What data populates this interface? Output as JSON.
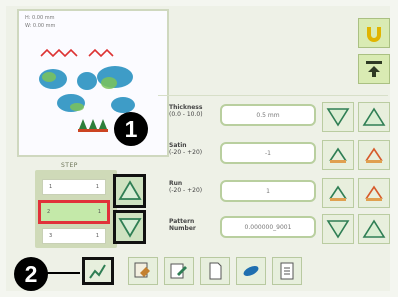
{
  "preview": {
    "line1": "H: 0.00 mm",
    "line2": "W: 0.00 mm"
  },
  "step": {
    "label": "STEP",
    "rows": [
      {
        "num": "1",
        "val": "1"
      },
      {
        "num": "2",
        "val": "1"
      },
      {
        "num": "3",
        "val": "1"
      }
    ]
  },
  "fields": {
    "thickness": {
      "label": "Thickness",
      "range": "(0.0 - 10.0)",
      "value": "0.5 mm"
    },
    "satin": {
      "label": "Satin",
      "range": "(-20 - +20)",
      "value": "-1"
    },
    "run": {
      "label": "Run",
      "range": "(-20 - +20)",
      "value": "1"
    },
    "pattern": {
      "label1": "Pattern",
      "label2": "Number",
      "value": "0.000000_9001"
    }
  },
  "markers": {
    "one": "1",
    "two": "2"
  },
  "icons": {
    "top_right": "horseshoe-icon",
    "top_right_2": "arrow-back-icon",
    "step_up": "triangle-up-icon",
    "step_down": "triangle-down-icon",
    "dec": "triangle-down-icon",
    "inc": "triangle-up-icon",
    "toolbar": [
      "step-mode-icon",
      "pattern-icon",
      "edit-icon",
      "page-icon",
      "thread-icon",
      "document-icon"
    ]
  },
  "colors": {
    "accent": "#d9ebb3",
    "highlight": "#e1313a",
    "marker": "#000000"
  }
}
